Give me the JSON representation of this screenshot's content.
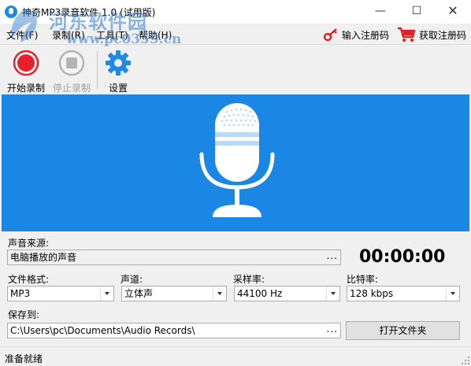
{
  "window": {
    "title": "神奇MP3录音软件 1.0 (试用版)",
    "controls": {
      "minimize": "—",
      "maximize": "☐",
      "close": "✕"
    }
  },
  "watermark": {
    "main": "河东软件园",
    "sub": "www.pc0359.cn"
  },
  "menu": {
    "items": [
      {
        "label": "文件(F)"
      },
      {
        "label": "录制(R)"
      },
      {
        "label": "工具(T)"
      },
      {
        "label": "帮助(H)"
      }
    ],
    "register_label": "输入注册码",
    "get_code_label": "获取注册码"
  },
  "toolbar": {
    "start_label": "开始录制",
    "stop_label": "停止录制",
    "settings_label": "设置"
  },
  "form": {
    "source_label": "声音来源:",
    "source_value": "电脑播放的声音",
    "timer": "00:00:00",
    "format_label": "文件格式:",
    "format_value": "MP3",
    "channel_label": "声道:",
    "channel_value": "立体声",
    "samplerate_label": "采样率:",
    "samplerate_value": "44100 Hz",
    "bitrate_label": "比特率:",
    "bitrate_value": "128 kbps",
    "save_label": "保存到:",
    "save_path": "C:\\Users\\pc\\Documents\\Audio Records\\",
    "browse_dots": "...",
    "open_folder_label": "打开文件夹"
  },
  "status": {
    "text": "准备就绪"
  },
  "colors": {
    "banner": "#1b87e5",
    "record_red": "#e8202a",
    "settings_blue": "#1e8ae6",
    "cart_red": "#e02020"
  }
}
